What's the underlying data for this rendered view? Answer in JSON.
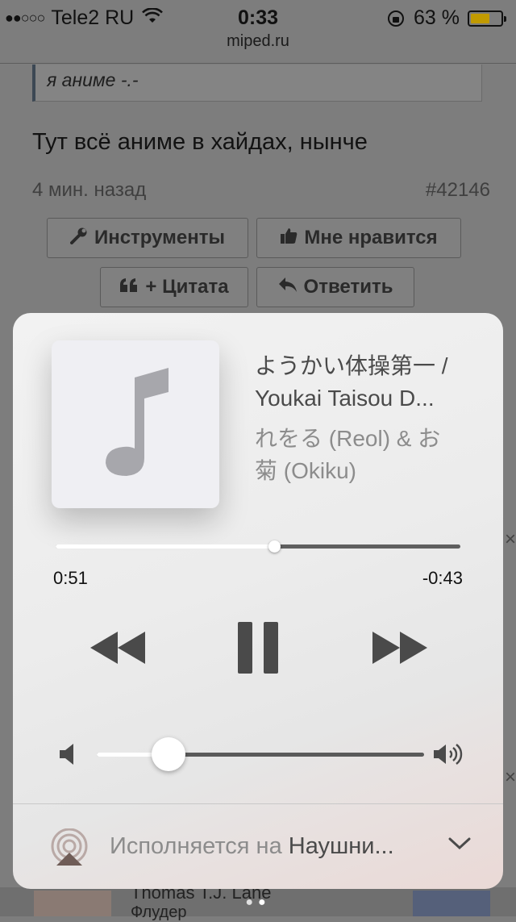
{
  "status_bar": {
    "signal_dots": "●●○○○",
    "carrier": "Tele2 RU",
    "time": "0:33",
    "battery_percent": "63 %",
    "battery_level": 0.63,
    "icons": [
      "wifi-icon",
      "orientation-lock-icon",
      "battery-icon"
    ]
  },
  "browser": {
    "url": "miped.ru"
  },
  "page": {
    "quote_text": "я аниме -.-",
    "post_text": "Тут всё аниме в хайдах, нынче",
    "post_time": "4 мин. назад",
    "post_id": "#42146",
    "buttons": {
      "tools": "Инструменты",
      "like": "Мне нравится",
      "quote": "+ Цитата",
      "reply": "Ответить"
    },
    "user_name": "Thomas T.J. Lane",
    "user_role": "Флудер",
    "close_glyph": "×"
  },
  "player": {
    "title_line1": "ようかい体操第一 /",
    "title_line2": "Youkai Taisou D...",
    "artist_line1": "れをる (Reol) & お",
    "artist_line2": "菊 (Okiku)",
    "elapsed": "0:51",
    "remaining": "-0:43",
    "progress": 0.54,
    "volume": 0.22,
    "airplay_prefix": "Исполняется на ",
    "airplay_device": "Наушни...",
    "page_index": 2,
    "page_count": 2
  },
  "colors": {
    "dim_background": "#7d7d7d",
    "card_background": "#efefef",
    "control_dark": "#4a4a4a",
    "artist_gray": "#8c8c8c",
    "battery_fill": "#c19a00"
  }
}
